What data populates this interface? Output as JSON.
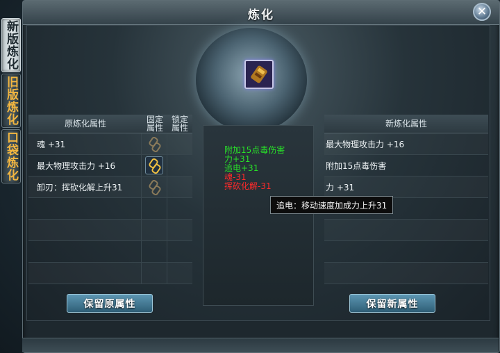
{
  "side_tabs": [
    {
      "label": "新版炼化",
      "active": true
    },
    {
      "label": "旧版炼化",
      "active": false
    },
    {
      "label": "口袋炼化",
      "active": false
    }
  ],
  "window": {
    "title": "炼化",
    "close_icon": "close-icon"
  },
  "item_slot": {
    "icon": "equipment-item-icon"
  },
  "left_table": {
    "header": {
      "attr": "原炼化属性",
      "fixed": "固定\n属性",
      "locked": "锁定\n属性"
    },
    "rows": [
      {
        "attr": "魂 +31",
        "fixed": false
      },
      {
        "attr": "最大物理攻击力 +16",
        "fixed": true
      },
      {
        "attr": "卸刃：挥砍化解上升31",
        "fixed": false
      }
    ]
  },
  "right_table": {
    "header": "新炼化属性",
    "rows": [
      "最大物理攻击力 +16",
      "附加15点毒伤害",
      "力 +31"
    ]
  },
  "preview": {
    "lines": [
      {
        "text": "附加15点毒伤害",
        "color": "#28e028"
      },
      {
        "text": "力+31",
        "color": "#28e028"
      },
      {
        "text": "追电+31",
        "color": "#28e028"
      },
      {
        "text": "魂-31",
        "color": "#ff2a2a"
      },
      {
        "text": "挥砍化解-31",
        "color": "#ff2a2a"
      }
    ]
  },
  "tooltip": "追电：移动速度加成力上升31",
  "buttons": {
    "keep_original": "保留原属性",
    "keep_new": "保留新属性"
  }
}
